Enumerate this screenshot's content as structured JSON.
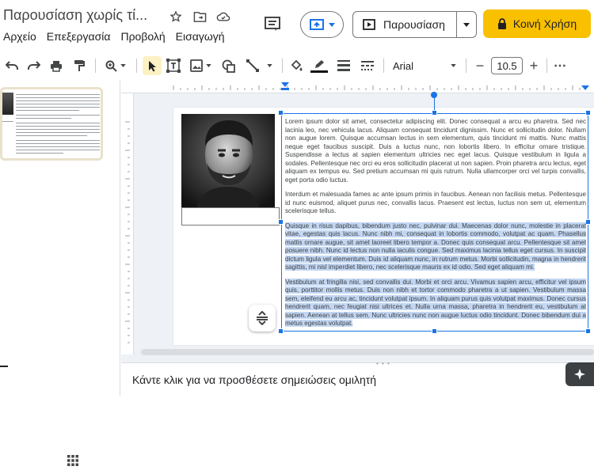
{
  "header": {
    "doc_title": "Παρουσίαση χωρίς τί...",
    "menu": [
      "Αρχείο",
      "Επεξεργασία",
      "Προβολή",
      "Εισαγωγή"
    ],
    "present_label": "Παρουσίαση",
    "share_label": "Κοινή Χρήση"
  },
  "toolbar": {
    "font": "Arial",
    "font_size": "10.5",
    "minus": "−",
    "plus": "+",
    "more": "⋯"
  },
  "slide": {
    "paragraphs": [
      {
        "text": "Lorem ipsum dolor sit amet, consectetur adipiscing elit. Donec consequat a arcu eu pharetra. Sed nec lacinia leo, nec vehicula lacus. Aliquam consequat tincidunt dignissim. Nunc et sollicitudin dolor. Nullam non augue lorem. Quisque accumsan lectus in sem elementum, quis tincidunt mi mattis. Nunc mattis neque eget faucibus suscipit. Duis a luctus nunc, non lobortis libero. In efficitur ornare tristique. Suspendisse a lectus at sapien elementum ultricies nec eget lacus. Quisque vestibulum in ligula a sodales. Pellentesque nec orci eu eros sollicitudin placerat ut non sapien. Proin pharetra arcu lectus, eget aliquam ex tempus eu. Sed pretium accumsan mi quis rutrum. Nulla ullamcorper orci vel turpis convallis, eget porta odio luctus.",
        "selected": false
      },
      {
        "text": "Interdum et malesuada fames ac ante ipsum primis in faucibus. Aenean non facilisis metus. Pellentesque id nunc euismod, aliquet purus nec, convallis lacus. Praesent est lectus, luctus non sem ut, elementum scelerisque tellus.",
        "selected": false
      },
      {
        "text": "Quisque in risus dapibus, bibendum justo nec, pulvinar dui. Maecenas dolor nunc, molestie in placerat vitae, egestas quis lacus. Nunc nibh mi, consequat in lobortis commodo, volutpat ac quam. Phasellus mattis ornare augue, sit amet laoreet libero tempor a. Donec quis consequat arcu. Pellentesque sit amet posuere nibh. Nunc id lectus non nulla iaculis congue. Sed maximus lacinia tellus eget cursus. In suscipit dictum ligula vel elementum. Duis id aliquam nunc, in rutrum metus. Morbi sollicitudin, magna in hendrerit sagittis, mi nisl imperdiet libero, nec scelerisque mauris ex id odio. Sed eget aliquam mi.",
        "selected": true
      },
      {
        "text": "Vestibulum at fringilla nisi, sed convallis dui. Morbi et orci arcu. Vivamus sapien arcu, efficitur vel ipsum quis, porttitor mollis metus. Duis non nibh et tortor commodo pharetra a ut sapien. Vestibulum massa sem, eleifend eu arcu ac, tincidunt volutpat ipsum. In aliquam purus quis volutpat maximus. Donec cursus hendrerit quam, nec feugiat nisi ultrices et. Nulla urna massa, pharetra in hendrerit eu, vestibulum at sapien. Aenean at tellus sem. Nunc ultricies nunc non augue luctus odio tincidunt. Donec bibendum dui a metus egestas volutpat.",
        "selected": true
      }
    ]
  },
  "speaker_notes": {
    "placeholder": "Κάντε κλικ για να προσθέσετε σημειώσεις ομιλητή"
  },
  "colors": {
    "accent": "#1a73e8",
    "share": "#f9c000",
    "selection": "#c3d7f3"
  }
}
